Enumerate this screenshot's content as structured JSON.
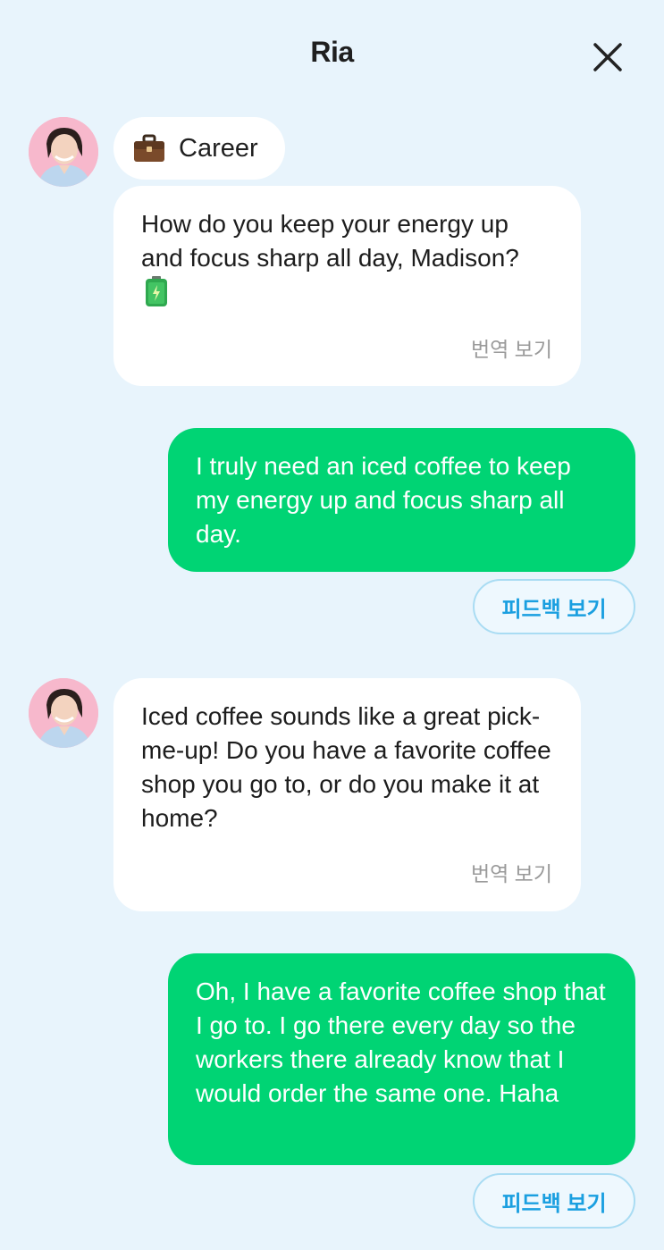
{
  "header": {
    "title": "Ria",
    "close_icon": "close-icon"
  },
  "topic": {
    "icon": "briefcase-icon",
    "label": "Career"
  },
  "messages": [
    {
      "sender": "bot",
      "text": "How do you keep your energy up and focus sharp all day, Madison?",
      "emoji": "battery-icon",
      "translate_label": "번역 보기"
    },
    {
      "sender": "user",
      "text": "I truly need an iced coffee to keep my energy up and focus sharp all day.",
      "feedback_label": "피드백 보기"
    },
    {
      "sender": "bot",
      "text": "Iced coffee sounds like a great pick-me-up! Do you have a favorite coffee shop you go to, or do you make it at home?",
      "translate_label": "번역 보기"
    },
    {
      "sender": "user",
      "text": "Oh, I have a favorite coffee shop that I go to. I go there every day so the workers there already know that I would order the same one. Haha",
      "feedback_label": "피드백 보기"
    }
  ],
  "colors": {
    "background": "#e8f4fc",
    "user_bubble": "#00d474",
    "bot_bubble": "#ffffff",
    "feedback_text": "#1a9fe0",
    "feedback_border": "#a9dcf3",
    "translate_text": "#9a9a9a"
  }
}
